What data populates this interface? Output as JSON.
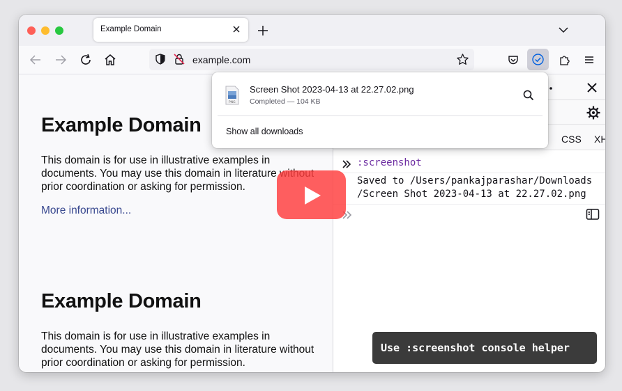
{
  "tab": {
    "title": "Example Domain"
  },
  "urlbar": {
    "url": "example.com"
  },
  "page": {
    "sections": [
      {
        "heading": "Example Domain",
        "paragraph": "This domain is for use in illustrative examples in documents. You may use this domain in literature without prior coordination or asking for permission.",
        "link": "More information..."
      },
      {
        "heading": "Example Domain",
        "paragraph": "This domain is for use in illustrative examples in documents. You may use this domain in literature without prior coordination or asking for permission."
      }
    ]
  },
  "devtools": {
    "filter_tabs": [
      "CSS",
      "XH"
    ],
    "console": {
      "command": ":screenshot",
      "output_line1": "Saved to /Users/pankajparashar/Downloads",
      "output_line2": "/Screen Shot 2023-04-13 at 22.27.02.png"
    }
  },
  "downloads_panel": {
    "file_name": "Screen Shot 2023-04-13 at 22.27.02.png",
    "status": "Completed — 104 KB",
    "show_all_label": "Show all downloads"
  },
  "caption": {
    "text": "Use :screenshot console helper"
  },
  "icons": [
    "close-icon",
    "plus-icon",
    "chevron-down-icon",
    "back-icon",
    "forward-icon",
    "reload-icon",
    "home-icon",
    "shield-icon",
    "lock-icon",
    "star-icon",
    "pocket-icon",
    "download-icon",
    "extensions-icon",
    "menu-icon",
    "more-icon",
    "gear-icon",
    "chevrons-right-icon",
    "sidebar-icon",
    "search-icon",
    "file-icon",
    "play-icon"
  ],
  "colors": {
    "accent": "#0060df",
    "play_button": "#ff3c3c",
    "link": "#38488f",
    "console_command": "#6b2aa0"
  }
}
